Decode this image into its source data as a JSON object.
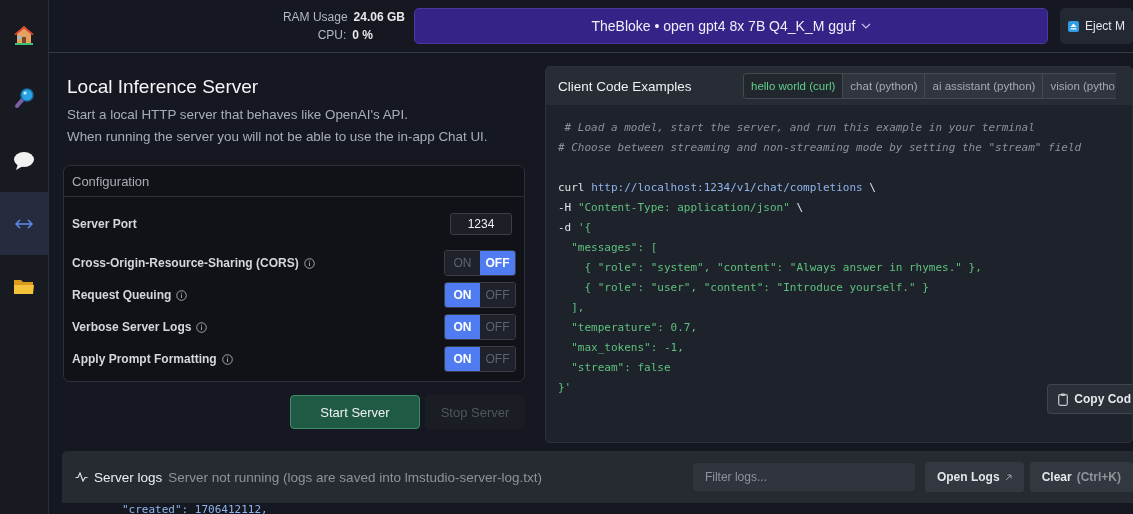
{
  "sidebar": {
    "items": [
      {
        "selected": false
      },
      {
        "selected": false
      },
      {
        "selected": false
      },
      {
        "selected": true
      },
      {
        "selected": false
      }
    ]
  },
  "top_bar": {
    "ram_label": "RAM Usage",
    "ram_value": "24.06 GB",
    "cpu_label": "CPU:",
    "cpu_value": "0 %",
    "model": "TheBloke • open gpt4 8x 7B Q4_K_M gguf",
    "eject": "Eject M"
  },
  "server": {
    "title": "Local Inference Server",
    "description": [
      "Start a local HTTP server that behaves like OpenAI's API.",
      "When running the server you will not be able to use the in-app Chat UI."
    ]
  },
  "configuration": {
    "title": "Configuration",
    "rows": [
      {
        "kind": "number",
        "label": "Server Port",
        "value": "1234"
      },
      {
        "kind": "toggle",
        "label": "Cross-Origin-Resource-Sharing (CORS)",
        "info": true,
        "on": false,
        "on_label": "ON",
        "off_label": "OFF"
      },
      {
        "kind": "toggle",
        "label": "Request Queuing",
        "info": true,
        "on": true,
        "on_label": "ON",
        "off_label": "OFF"
      },
      {
        "kind": "toggle",
        "label": "Verbose Server Logs",
        "info": true,
        "on": true,
        "on_label": "ON",
        "off_label": "OFF"
      },
      {
        "kind": "toggle",
        "label": "Apply Prompt Formatting",
        "info": true,
        "on": true,
        "on_label": "ON",
        "off_label": "OFF"
      }
    ]
  },
  "buttons": [
    {
      "label": "Start Server",
      "kind": "primary",
      "disabled": false
    },
    {
      "label": "Stop Server",
      "kind": "secondary",
      "disabled": true
    }
  ],
  "code_examples": {
    "title": "Client Code Examples",
    "tabs": [
      {
        "label": "hello world (curl)",
        "selected": true
      },
      {
        "label": "chat (python)",
        "selected": false
      },
      {
        "label": "ai assistant (python)",
        "selected": false
      },
      {
        "label": "vision (pytho",
        "selected": false
      }
    ],
    "comments": [
      " # Load a model, start the server, and run this example in your terminal",
      "# Choose between streaming and non-streaming mode by setting the \"stream\" field"
    ],
    "lines": [
      [
        {
          "kind": "plain",
          "text": "curl "
        },
        {
          "kind": "url",
          "text": "http://localhost:1234/v1/chat/completions"
        },
        {
          "kind": "plain",
          "text": " \\"
        }
      ],
      [
        {
          "kind": "plain",
          "text": "-H "
        },
        {
          "kind": "string",
          "text": "\"Content-Type: application/json\""
        },
        {
          "kind": "plain",
          "text": " \\"
        }
      ],
      [
        {
          "kind": "plain",
          "text": "-d "
        },
        {
          "kind": "string",
          "text": "'{"
        }
      ],
      [
        {
          "kind": "string",
          "text": "  \"messages\": ["
        }
      ],
      [
        {
          "kind": "string",
          "text": "    { \"role\": \"system\", \"content\": \"Always answer in rhymes.\" },"
        }
      ],
      [
        {
          "kind": "string",
          "text": "    { \"role\": \"user\", \"content\": \"Introduce yourself.\" }"
        }
      ],
      [
        {
          "kind": "string",
          "text": "  ],"
        }
      ],
      [
        {
          "kind": "string",
          "text": "  \"temperature\": 0.7,"
        }
      ],
      [
        {
          "kind": "string",
          "text": "  \"max_tokens\": -1,"
        }
      ],
      [
        {
          "kind": "string",
          "text": "  \"stream\": false"
        }
      ],
      [
        {
          "kind": "string",
          "text": "}'"
        }
      ]
    ],
    "copy_button": "Copy Cod"
  },
  "logs": {
    "title": "Server logs",
    "status": "Server not running (logs are saved into lmstudio-server-log.txt)",
    "filter_placeholder": "Filter logs...",
    "open_button": "Open Logs",
    "clear_button": "Clear",
    "clear_shortcut": "(Ctrl+K)",
    "last_line": "\"created\": 1706412112,"
  }
}
